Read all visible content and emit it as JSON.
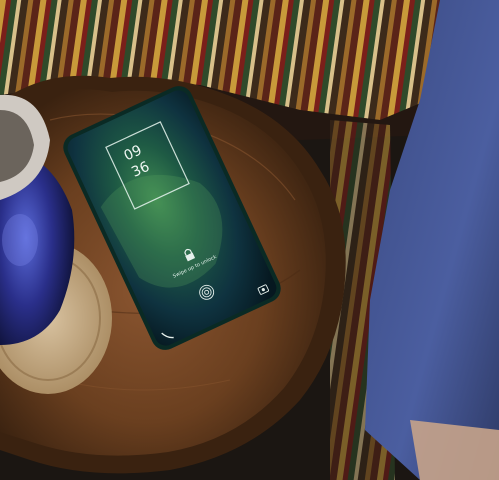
{
  "photo": {
    "subject": "smartphone-lock-screen",
    "colors": {
      "cushion_stripes": [
        "#c89a3a",
        "#7a1f1a",
        "#2f4a2a",
        "#d8c08a",
        "#3c2a1a",
        "#9b6a2a"
      ],
      "sofa_arm": "#4b5ea0",
      "table_wood": "#6a3f1f",
      "phone_wallpaper": "#1e5a44"
    },
    "phone_screen": {
      "time_hour": "09",
      "time_minute": "36",
      "unlock_hint": "Swipe up to unlock"
    },
    "icons": [
      "lock-icon",
      "fingerprint-icon",
      "camera-icon",
      "phone-icon"
    ]
  }
}
